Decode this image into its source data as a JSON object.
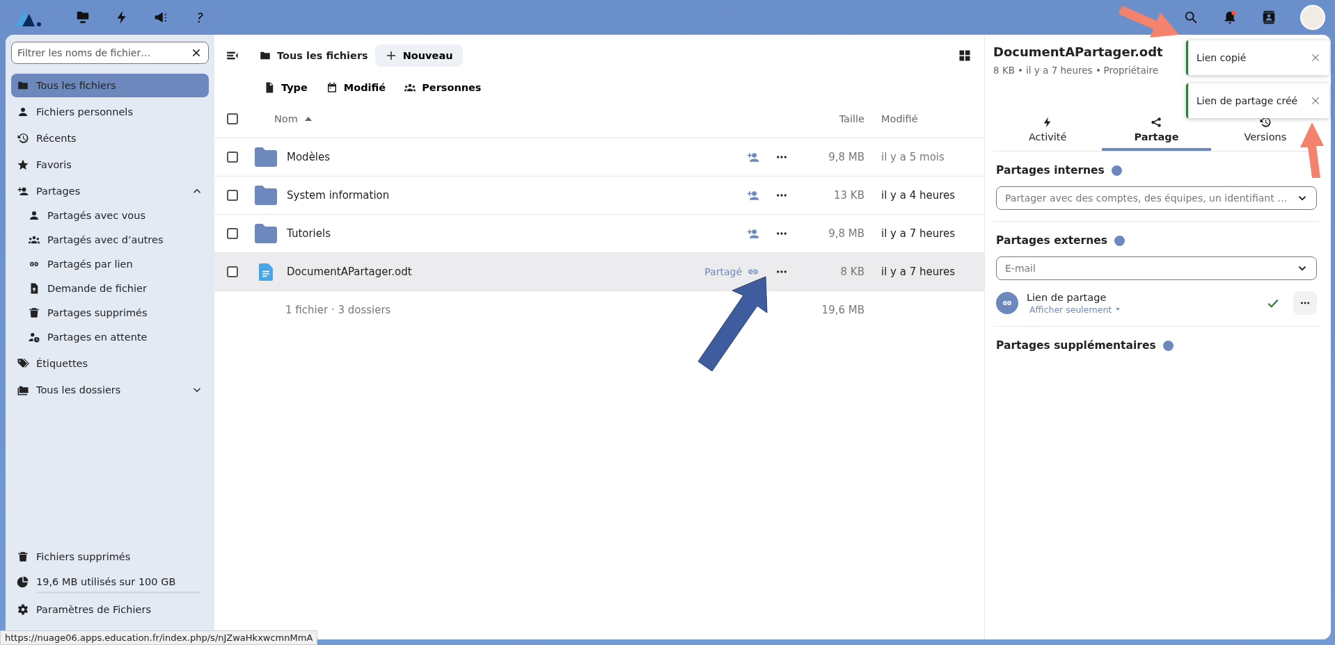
{
  "sidebar": {
    "filter": {
      "placeholder": "Filtrer les noms de fichier…"
    },
    "items": [
      {
        "label": "Tous les fichiers",
        "selected": true
      },
      {
        "label": "Fichiers personnels",
        "selected": false
      },
      {
        "label": "Récents",
        "selected": false
      },
      {
        "label": "Favoris",
        "selected": false
      },
      {
        "label": "Partages",
        "selected": false,
        "expanded": true,
        "children": [
          {
            "label": "Partagés avec vous",
            "selected": false
          },
          {
            "label": "Partagés avec d’autres",
            "selected": false
          },
          {
            "label": "Partagés par lien",
            "selected": false
          },
          {
            "label": "Demande de fichier",
            "selected": false
          },
          {
            "label": "Partages supprimés",
            "selected": false
          },
          {
            "label": "Partages en attente",
            "selected": false
          }
        ]
      },
      {
        "label": "Étiquettes",
        "selected": false
      },
      {
        "label": "Tous les dossiers",
        "selected": false,
        "expanded": false
      }
    ],
    "footer": [
      {
        "label": "Fichiers supprimés",
        "kind": "link"
      },
      {
        "label": "19,6 MB utilisés sur 100 GB",
        "kind": "quota",
        "level": 0.0002
      },
      {
        "label": "Paramètres de Fichiers",
        "kind": "link"
      }
    ]
  },
  "toolbar": {
    "breadcrumb": "Tous les fichiers",
    "new_button": "Nouveau"
  },
  "filters": [
    {
      "label": "Type"
    },
    {
      "label": "Modifié"
    },
    {
      "label": "Personnes"
    }
  ],
  "table": {
    "columns": [
      "Nom",
      "Taille",
      "Modifié"
    ],
    "all_checked": false,
    "rows": [
      {
        "name": "Modèles",
        "kind": "folder",
        "checked": false,
        "shared": false,
        "size": "9,8 MB",
        "modified": "il y a 5 mois",
        "dim": true,
        "active": false
      },
      {
        "name": "System information",
        "kind": "folder",
        "checked": false,
        "shared": false,
        "size": "13 KB",
        "modified": "il y a 4 heures",
        "dim": false,
        "active": false
      },
      {
        "name": "Tutoriels",
        "kind": "folder",
        "checked": false,
        "shared": false,
        "size": "9,8 MB",
        "modified": "il y a 7 heures",
        "dim": false,
        "active": false
      },
      {
        "name": "DocumentAPartager.odt",
        "kind": "document",
        "checked": false,
        "shared": true,
        "share_label": "Partagé",
        "size": "8 KB",
        "modified": "il y a 7 heures",
        "dim": false,
        "active": true
      }
    ],
    "summary": "1 fichier · 3 dossiers",
    "total": "19,6 MB"
  },
  "details": {
    "title": "DocumentAPartager.odt",
    "meta": [
      "8 KB",
      "il y a 7 heures",
      "Propriétaire"
    ],
    "tabs": [
      {
        "label": "Activité",
        "selected": false
      },
      {
        "label": "Partage",
        "selected": true
      },
      {
        "label": "Versions",
        "selected": false
      }
    ],
    "internal": {
      "heading": "Partages internes",
      "placeholder": "Partager avec des comptes, des équipes, un identifiant …"
    },
    "external": {
      "heading": "Partages externes",
      "placeholder": "E-mail"
    },
    "link_share": {
      "title": "Lien de partage",
      "permission": "Afficher seulement"
    },
    "additional": {
      "heading": "Partages supplémentaires"
    }
  },
  "toasts": [
    "Lien copié",
    "Lien de partage créé"
  ],
  "status_url": "https://nuage06.apps.education.fr/index.php/s/nJZwaHkxwcmnMmA"
}
